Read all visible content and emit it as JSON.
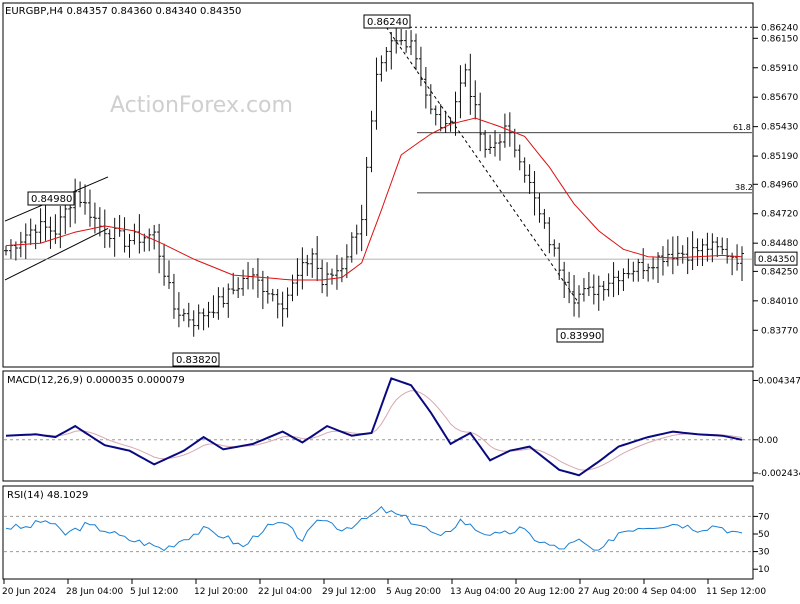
{
  "chart_data": {
    "type": "ohlc",
    "symbol_header": "EURGBP,H4  0.84357 0.84360 0.84340 0.84350",
    "watermark": "ActionForex.com",
    "price_ticks": [
      "0.86240",
      "0.86150",
      "0.85910",
      "0.85670",
      "0.85430",
      "0.85190",
      "0.84960",
      "0.84720",
      "0.84480",
      "0.84250",
      "0.84010",
      "0.83770"
    ],
    "price_range": [
      0.8365,
      0.8634
    ],
    "current_price": "0.84350",
    "x_labels": [
      "20 Jun 2024",
      "28 Jun 04:00",
      "5 Jul 12:00",
      "12 Jul 20:00",
      "22 Jul 04:00",
      "29 Jul 12:00",
      "5 Aug 20:00",
      "13 Aug 04:00",
      "20 Aug 12:00",
      "27 Aug 20:00",
      "4 Sep 04:00",
      "11 Sep 12:00"
    ],
    "annotations": {
      "high_1": "0.84980",
      "low_1": "0.83820",
      "peak": "0.86240",
      "low_2": "0.83990",
      "fib_618": "61.8",
      "fib_382": "38.2"
    },
    "price_series": {
      "n": 150,
      "x_knots": [
        0,
        6,
        10,
        14,
        19,
        24,
        30,
        34,
        38,
        44,
        49,
        53,
        56,
        59,
        62,
        64,
        68,
        72,
        75,
        78,
        82,
        86,
        89,
        93,
        97,
        101,
        104,
        108,
        112,
        115,
        118,
        122,
        125,
        129,
        134,
        138,
        142,
        146,
        149
      ],
      "y_knots": [
        0.8442,
        0.8462,
        0.8458,
        0.849,
        0.8462,
        0.845,
        0.8455,
        0.8395,
        0.8385,
        0.8402,
        0.8422,
        0.841,
        0.84,
        0.842,
        0.844,
        0.8415,
        0.843,
        0.847,
        0.858,
        0.861,
        0.8615,
        0.8555,
        0.854,
        0.859,
        0.852,
        0.854,
        0.852,
        0.847,
        0.843,
        0.8405,
        0.8408,
        0.8418,
        0.8425,
        0.843,
        0.844,
        0.844,
        0.8445,
        0.844,
        0.8435
      ]
    },
    "ma_series": {
      "x_knots": [
        0,
        7,
        14,
        20,
        26,
        32,
        38,
        46,
        52,
        58,
        64,
        68,
        72,
        76,
        80,
        86,
        90,
        95,
        100,
        105,
        110,
        115,
        120,
        125,
        130,
        135,
        140,
        145,
        149
      ],
      "y_knots": [
        0.8446,
        0.8448,
        0.8457,
        0.8462,
        0.8458,
        0.8447,
        0.8435,
        0.8422,
        0.842,
        0.8418,
        0.8418,
        0.842,
        0.8432,
        0.8475,
        0.852,
        0.8537,
        0.8545,
        0.855,
        0.8543,
        0.8535,
        0.851,
        0.848,
        0.8458,
        0.8443,
        0.8437,
        0.8436,
        0.8437,
        0.8438,
        0.8437
      ]
    },
    "macd": {
      "label": "MACD(12,26,9) 0.000035 0.000079",
      "ticks": [
        "0.004347",
        "0.00",
        "-0.002434"
      ],
      "range": [
        -0.0028,
        0.0046
      ],
      "x_knots": [
        0,
        6,
        10,
        14,
        20,
        25,
        30,
        36,
        40,
        44,
        50,
        56,
        60,
        65,
        70,
        74,
        78,
        82,
        86,
        90,
        94,
        98,
        102,
        106,
        112,
        116,
        120,
        124,
        130,
        135,
        140,
        145,
        149
      ],
      "y_knots": [
        0.0003,
        0.0004,
        0.0002,
        0.001,
        -0.0004,
        -0.0008,
        -0.0018,
        -0.0008,
        0.0002,
        -0.0007,
        -0.0003,
        0.0006,
        -0.0002,
        0.001,
        0.0003,
        0.0005,
        0.0045,
        0.004,
        0.002,
        -0.0003,
        0.0005,
        -0.0015,
        -0.0008,
        -0.0005,
        -0.0022,
        -0.0026,
        -0.0016,
        -0.0005,
        0.0002,
        0.0006,
        0.0004,
        0.0003,
        0.0
      ]
    },
    "rsi": {
      "label": "RSI(14) 48.1029",
      "ticks": [
        "70",
        "50",
        "30",
        "10"
      ],
      "range": [
        0,
        100
      ],
      "x_knots": [
        0,
        4,
        8,
        12,
        16,
        20,
        24,
        28,
        32,
        36,
        40,
        44,
        48,
        52,
        56,
        60,
        64,
        68,
        72,
        76,
        80,
        84,
        88,
        92,
        96,
        100,
        104,
        108,
        112,
        116,
        120,
        124,
        128,
        132,
        136,
        140,
        144,
        149
      ],
      "y_knots": [
        58,
        57,
        66,
        50,
        60,
        55,
        45,
        40,
        33,
        45,
        55,
        48,
        35,
        56,
        62,
        44,
        68,
        56,
        64,
        78,
        70,
        60,
        45,
        66,
        53,
        48,
        56,
        42,
        33,
        42,
        28,
        52,
        58,
        60,
        62,
        56,
        60,
        48
      ]
    }
  }
}
